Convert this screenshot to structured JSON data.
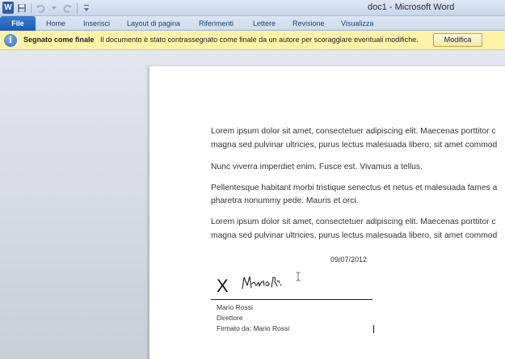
{
  "window": {
    "title": "doc1  -  Microsoft Word",
    "app_icon": "W"
  },
  "quick_access": {
    "icons": [
      "save-icon",
      "undo-icon",
      "redo-icon",
      "customize-icon"
    ]
  },
  "ribbon": {
    "file_label": "File",
    "tabs": [
      "Home",
      "Inserisci",
      "Layout di pagina",
      "Riferimenti",
      "Lettere",
      "Revisione",
      "Visualizza"
    ]
  },
  "message_bar": {
    "icon": "info-icon",
    "title": "Segnato come finale",
    "text": "Il documento è stato contrassegnato come finale da un autore per scoraggiare eventuali modifiche.",
    "button_label": "Modifica",
    "background_color": "#fff3a8"
  },
  "document": {
    "paragraphs": [
      [
        "Lorem ipsum dolor sit amet, consectetuer adipiscing elit. Maecenas porttitor c",
        "magna sed pulvinar ultricies, purus lectus malesuada libero, sit amet commod"
      ],
      [
        "Nunc viverra imperdiet enim. Fusce est. Vivamus a tellus."
      ],
      [
        "Pellentesque habitant morbi tristique senectus et netus et malesuada fames a",
        "pharetra nonummy pede. Mauris et orci."
      ],
      [
        "Lorem ipsum dolor sit amet, consectetuer adipiscing elit. Maecenas porttitor c",
        "magna sed pulvinar ultricies, purus lectus malesuada libero, sit amet commod"
      ]
    ],
    "signature": {
      "date": "09/07/2012",
      "mark": "X",
      "signer_name": "Mario Rossi",
      "signer_title": "Direttore",
      "signed_by": "Firmato da: Mario Rossi",
      "handwritten": "Mario Rossi"
    }
  }
}
